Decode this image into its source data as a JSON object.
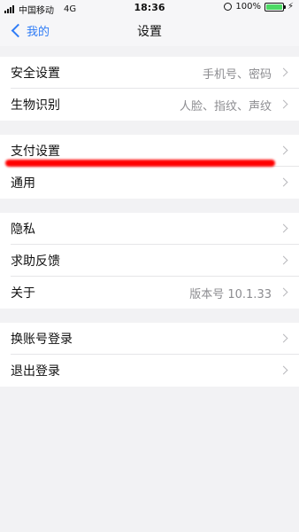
{
  "status_bar": {
    "carrier": "中国移动",
    "network": "4G",
    "time": "18:36",
    "battery": "100%",
    "battery_level": 1.0,
    "battery_color": "#4cd964"
  },
  "nav": {
    "back_label": "我的",
    "title": "设置",
    "accent": "#2f7cf6"
  },
  "groups": [
    {
      "items": [
        {
          "label": "安全设置",
          "value": "手机号、密码"
        },
        {
          "label": "生物识别",
          "value": "人脸、指纹、声纹"
        }
      ]
    },
    {
      "items": [
        {
          "label": "支付设置",
          "value": ""
        },
        {
          "label": "通用",
          "value": ""
        }
      ]
    },
    {
      "items": [
        {
          "label": "隐私",
          "value": ""
        },
        {
          "label": "求助反馈",
          "value": ""
        },
        {
          "label": "关于",
          "value": "版本号 10.1.33"
        }
      ]
    },
    {
      "items": [
        {
          "label": "换账号登录",
          "value": ""
        },
        {
          "label": "退出登录",
          "value": ""
        }
      ]
    }
  ],
  "annotation": {
    "mark_color": "#ff0000"
  }
}
